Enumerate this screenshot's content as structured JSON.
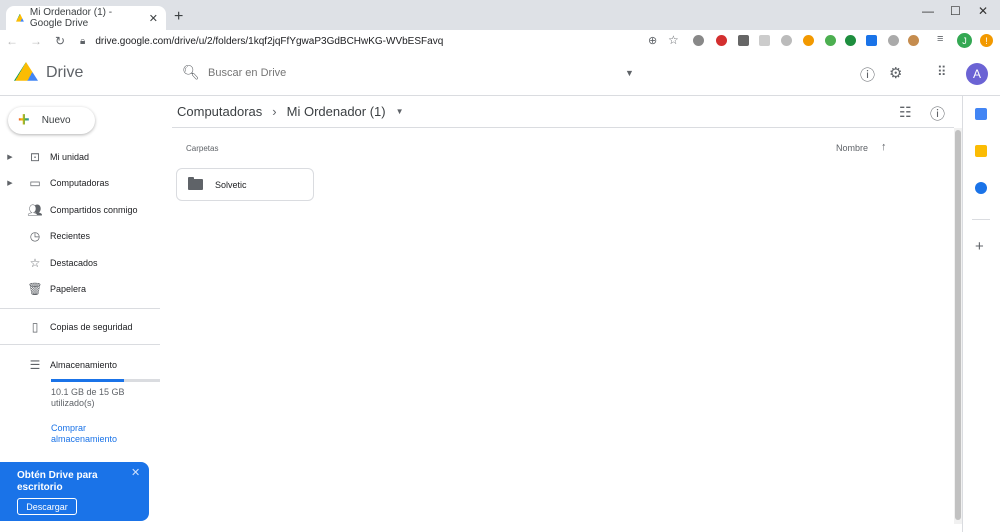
{
  "browser": {
    "tab_title": "Mi Ordenador (1) - Google Drive",
    "url": "drive.google.com/drive/u/2/folders/1kqf2jqFfYgwaP3GdBCHwKG-WVbESFavq",
    "profile_initial": "J"
  },
  "header": {
    "app_name": "Drive",
    "search_placeholder": "Buscar en Drive",
    "avatar_initial": "A"
  },
  "sidebar": {
    "new_label": "Nuevo",
    "items": [
      {
        "label": "Mi unidad",
        "icon": "drive-icon"
      },
      {
        "label": "Computadoras",
        "icon": "computer-icon"
      },
      {
        "label": "Compartidos conmigo",
        "icon": "people-icon"
      },
      {
        "label": "Recientes",
        "icon": "clock-icon"
      },
      {
        "label": "Destacados",
        "icon": "star-icon"
      },
      {
        "label": "Papelera",
        "icon": "trash-icon"
      },
      {
        "label": "Copias de seguridad",
        "icon": "backup-icon"
      }
    ],
    "storage": {
      "label": "Almacenamiento",
      "usage": "10.1 GB de 15 GB utilizado(s)",
      "used_fraction": 0.673,
      "buy_link": "Comprar almacenamiento"
    },
    "promo": {
      "title": "Obtén Drive para escritorio",
      "button": "Descargar"
    }
  },
  "main": {
    "breadcrumb": [
      "Computadoras",
      "Mi Ordenador (1)"
    ],
    "section": "Carpetas",
    "sort_label": "Nombre",
    "folders": [
      {
        "name": "Solvetic"
      }
    ]
  },
  "colors": {
    "accent": "#1a73e8",
    "avatar": "#6b63d4"
  }
}
